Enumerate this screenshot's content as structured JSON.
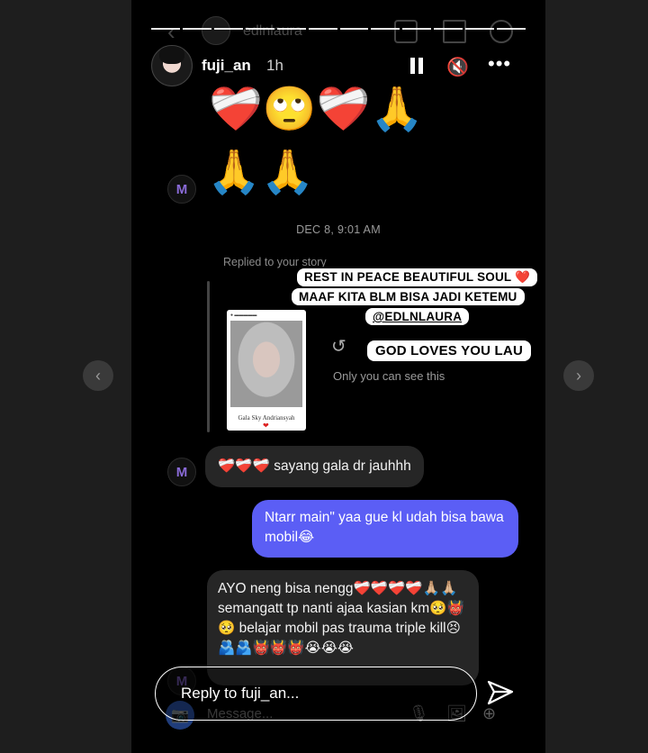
{
  "colors": {
    "outgoing_bubble": "#5b5ef5",
    "incoming_bubble": "#262626",
    "story_bg": "#000000",
    "page_bg": "#1e1e1e"
  },
  "nav": {
    "prev_icon": "chevron-left-icon",
    "next_icon": "chevron-right-icon",
    "prev_glyph": "‹",
    "next_glyph": "›"
  },
  "underlying_dm": {
    "name": "edlnlaura",
    "back_glyph": "‹"
  },
  "story_header": {
    "username": "fuji_an",
    "time": "1h",
    "mute_glyph": "🔇",
    "more_glyph": "•••"
  },
  "emojis": {
    "row1": "❤️‍🩹🙄❤️‍🩹🙏",
    "row2": "🙏🙏"
  },
  "bot_avatar_glyph": "M",
  "chat": {
    "timestamp": "DEC 8, 9:01 AM",
    "replied_label": "Replied to your story",
    "story_caption": "Gala Sky Andriansyah",
    "story_heart": "❤",
    "stickers": [
      "REST IN PEACE BEAUTIFUL SOUL ❤️",
      "MAAF KITA BLM BISA JADI KETEMU",
      "@EDLNLAURA",
      "GOD LOVES YOU LAU"
    ],
    "reply_icon_glyph": "↺",
    "only_you": "Only you can see this",
    "messages": [
      {
        "direction": "incoming",
        "text": "❤️‍🩹❤️‍🩹❤️‍🩹 sayang gala dr jauhhh"
      },
      {
        "direction": "outgoing",
        "text": "Ntarr main\" yaa gue kl udah bisa bawa mobil😂"
      },
      {
        "direction": "incoming",
        "text": "AYO neng bisa nengg❤️‍🩹❤️‍🩹❤️‍🩹❤️‍🩹🙏🏼🙏🏼 semangatt tp nanti ajaa kasian km🥺👹🥺 belajar mobil pas trauma triple kill😣🫂🫂👹👹👹😭😭😭"
      }
    ]
  },
  "composer": {
    "placeholder": "Reply to fuji_an...",
    "underlay_placeholder": "Message...",
    "camera_glyph": "📷",
    "mic_glyph": "🎙",
    "image_glyph": "🖼",
    "plus_glyph": "⊕"
  }
}
